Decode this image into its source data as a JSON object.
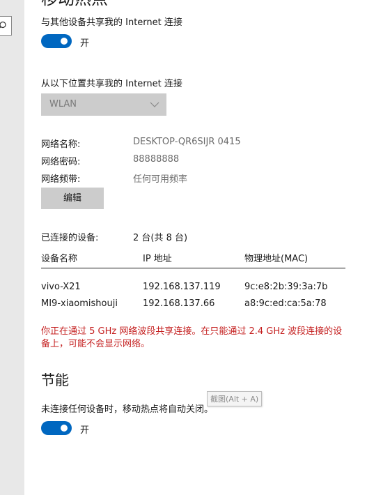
{
  "page": {
    "title": "移动热点"
  },
  "share": {
    "label": "与其他设备共享我的 Internet 连接",
    "toggle_state": "开",
    "toggle_on": true
  },
  "share_from": {
    "label": "从以下位置共享我的 Internet 连接",
    "selected": "WLAN"
  },
  "network": {
    "name_label": "网络名称:",
    "name_value": "DESKTOP-QR6SIJR 0415",
    "password_label": "网络密码:",
    "password_value": "88888888",
    "band_label": "网络频带:",
    "band_value": "任何可用频率",
    "edit_button": "编辑"
  },
  "devices": {
    "connected_label": "已连接的设备:",
    "connected_value": "2 台(共 8 台)",
    "columns": [
      "设备名称",
      "IP 地址",
      "物理地址(MAC)"
    ],
    "rows": [
      {
        "name": "vivo-X21",
        "ip": "192.168.137.119",
        "mac": "9c:e8:2b:39:3a:7b"
      },
      {
        "name": "MI9-xiaomishouji",
        "ip": "192.168.137.66",
        "mac": "a8:9c:ed:ca:5a:78"
      }
    ]
  },
  "warning": "你正在通过 5 GHz 网络波段共享连接。在只能通过 2.4 GHz 波段连接的设备上，可能不会显示网络。",
  "power_saving": {
    "heading": "节能",
    "description": "未连接任何设备时，移动热点将自动关闭。",
    "toggle_state": "开",
    "toggle_on": true
  },
  "tooltip": "截图(Alt + A)",
  "colors": {
    "accent": "#0067c0",
    "warning": "#c41e1e",
    "sidebar": "#e8e8e8"
  },
  "icons": [
    "search-icon",
    "chevron-down-icon"
  ]
}
